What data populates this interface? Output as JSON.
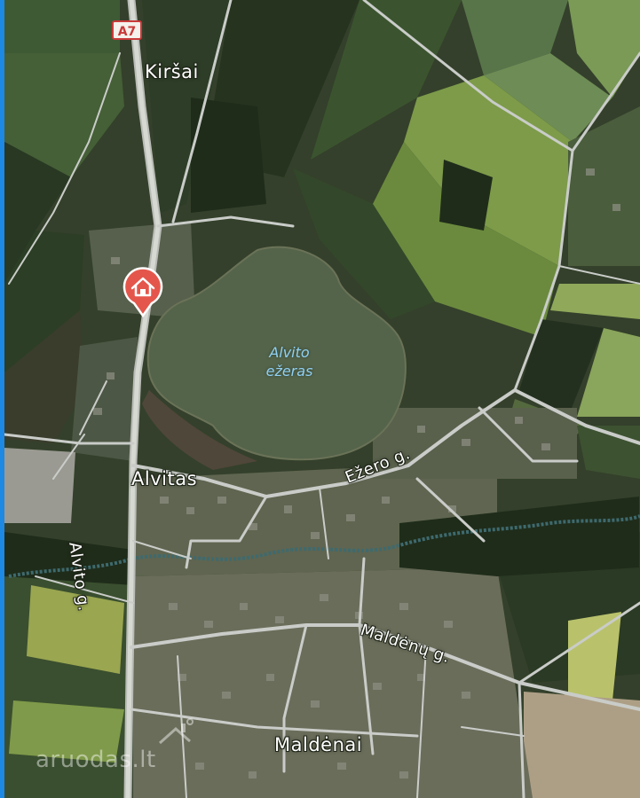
{
  "map": {
    "highway_shield": "A7",
    "places": {
      "kirsai": "Kiršai",
      "alvitas": "Alvitas",
      "maldenai": "Maldėnai"
    },
    "streets": {
      "alvito": "Alvito g.",
      "ezero": "Ežero g.",
      "maldenu": "Maldėnų g."
    },
    "lake": {
      "line1": "Alvito",
      "line2": "ežeras"
    },
    "property_marker": "house-icon",
    "watermark": "aruodas.lt"
  },
  "colors": {
    "road": "#c9ccc8",
    "marker": "#e4564b",
    "lake": "#54644a",
    "lake_label": "#8fd0f4",
    "shield_border": "#c93a3a",
    "side_strip": "#1e88e5",
    "river": "#3e6a6f"
  }
}
